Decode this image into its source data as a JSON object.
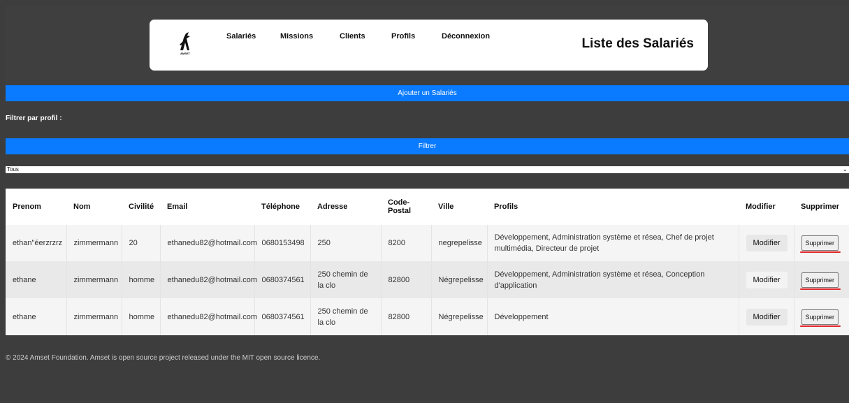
{
  "header": {
    "logo_text": "AMSET",
    "nav": [
      "Salariés",
      "Missions",
      "Clients",
      "Profils",
      "Déconnexion"
    ],
    "title": "Liste des Salariés"
  },
  "add_button": "Ajouter un Salariés",
  "filter": {
    "label": "Filtrer par profil :",
    "button": "Filtrer",
    "selected": "Tous"
  },
  "table": {
    "columns": [
      "Prenom",
      "Nom",
      "Civilité",
      "Email",
      "Téléphone",
      "Adresse",
      "Code-Postal",
      "Ville",
      "Profils",
      "Modifier",
      "Supprimer"
    ],
    "rows": [
      {
        "prenom": "ethan\"éerzrzrz",
        "nom": "zimmermann",
        "civilite": "20",
        "email": "ethanedu82@hotmail.com",
        "telephone": "0680153498",
        "adresse": "250",
        "code_postal": "8200",
        "ville": "negrepelisse",
        "profils": "Développement, Administration système et résea, Chef de projet multimédia, Directeur de projet",
        "modifier": "Modifier",
        "supprimer": "Supprimer"
      },
      {
        "prenom": "ethane",
        "nom": "zimmermann",
        "civilite": "homme",
        "email": "ethanedu82@hotmail.com",
        "telephone": "0680374561",
        "adresse": "250 chemin de la clo",
        "code_postal": "82800",
        "ville": "Négrepelisse",
        "profils": "Développement, Administration système et résea, Conception d'application",
        "modifier": "Modifier",
        "supprimer": "Supprimer"
      },
      {
        "prenom": "ethane",
        "nom": "zimmermann",
        "civilite": "homme",
        "email": "ethanedu82@hotmail.com",
        "telephone": "0680374561",
        "adresse": "250 chemin de la clo",
        "code_postal": "82800",
        "ville": "Négrepelisse",
        "profils": "Développement",
        "modifier": "Modifier",
        "supprimer": "Supprimer"
      }
    ]
  },
  "footer": "© 2024 Amset Foundation. Amset is open source project released under the MIT open source licence.",
  "colors": {
    "accent_blue": "#0a7bff",
    "background": "#3d3d3d",
    "annotation_red": "#e0262a"
  }
}
